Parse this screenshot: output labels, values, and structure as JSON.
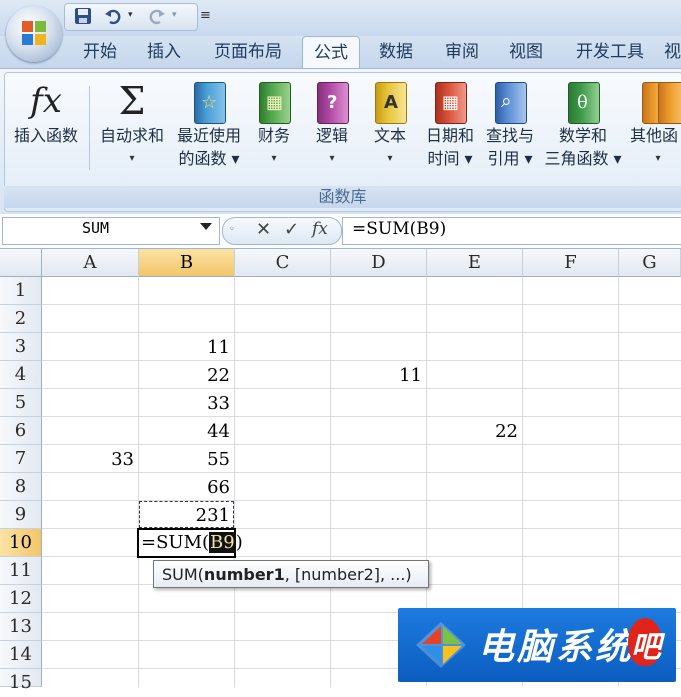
{
  "tabs": [
    "开始",
    "插入",
    "页面布局",
    "公式",
    "数据",
    "审阅",
    "视图",
    "开发工具",
    "视"
  ],
  "active_tab": "公式",
  "ribbon": {
    "group_label": "函数库",
    "buttons": [
      {
        "line1": "插入函数",
        "line2": ""
      },
      {
        "line1": "自动求和",
        "line2": "▾"
      },
      {
        "line1": "最近使用",
        "line2": "的函数 ▾"
      },
      {
        "line1": "财务",
        "line2": "▾"
      },
      {
        "line1": "逻辑",
        "line2": "▾"
      },
      {
        "line1": "文本",
        "line2": "▾"
      },
      {
        "line1": "日期和",
        "line2": "时间 ▾"
      },
      {
        "line1": "查找与",
        "line2": "引用 ▾"
      },
      {
        "line1": "数学和",
        "line2": "三角函数 ▾"
      },
      {
        "line1": "其他函",
        "line2": "▾"
      }
    ],
    "book_colors": [
      "#4aa0d8",
      "#53a94e",
      "#b24aa5",
      "#e8c53a",
      "#d9503a",
      "#5c8fd6",
      "#3e9a48",
      "#f0a030"
    ],
    "book_glyphs": [
      "☆",
      "▦",
      "?",
      "A",
      "▦",
      "⌕",
      "θ",
      ""
    ]
  },
  "namebox": {
    "value": "SUM"
  },
  "fx_buttons": {
    "cancel": "✕",
    "enter": "✓",
    "fx": "fx"
  },
  "formula": {
    "value": "=SUM(B9)"
  },
  "columns": [
    "A",
    "B",
    "C",
    "D",
    "E",
    "F",
    "G"
  ],
  "rows": [
    "1",
    "2",
    "3",
    "4",
    "5",
    "6",
    "7",
    "8",
    "9",
    "10",
    "11",
    "12",
    "13",
    "14",
    "15"
  ],
  "cells": {
    "B3": "11",
    "B4": "22",
    "B5": "33",
    "B6": "44",
    "A7": "33",
    "B7": "55",
    "B8": "66",
    "B9": "231",
    "D4": "11",
    "E6": "22"
  },
  "edit": {
    "prefix": "=SUM(",
    "ref": "B9",
    "suffix": ")"
  },
  "tooltip": {
    "func": "SUM(",
    "arg": "number1",
    "rest": ", [number2], ...)"
  },
  "watermark": {
    "text": "电脑系统",
    "badge": "吧"
  }
}
